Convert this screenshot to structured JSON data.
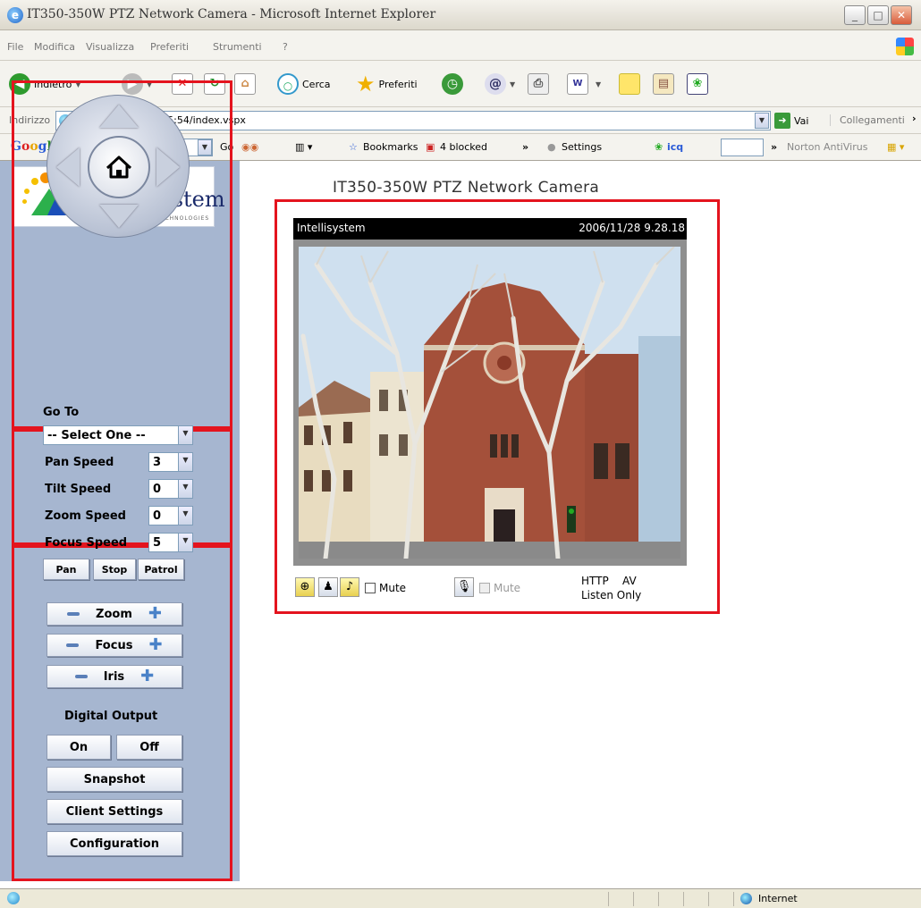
{
  "window": {
    "title": "IT350-350W PTZ Network Camera - Microsoft Internet Explorer"
  },
  "menu": [
    "File",
    "Modifica",
    "Visualizza",
    "Preferiti",
    "Strumenti",
    "?"
  ],
  "toolbar": {
    "back": "Indietro",
    "search": "Cerca",
    "favorites": "Preferiti"
  },
  "address": {
    "label": "Indirizzo",
    "url": "http://172.16.10.75:54/index.vspx",
    "go": "Vai",
    "links": "Collegamenti"
  },
  "google_bar": {
    "logo": "Google",
    "go": "Go",
    "bookmarks": "Bookmarks",
    "blocked": "4 blocked",
    "settings": "Settings",
    "icq": "icq",
    "norton": "Norton AntiVirus"
  },
  "logo": {
    "text": "Intellisystem",
    "tagline": "TECHNOLOGIES"
  },
  "ptz": {
    "goto_label": "Go To",
    "goto_value": "-- Select One --",
    "pan_speed_label": "Pan Speed",
    "pan_speed": "3",
    "tilt_speed_label": "Tilt Speed",
    "tilt_speed": "0",
    "zoom_speed_label": "Zoom Speed",
    "zoom_speed": "0",
    "focus_speed_label": "Focus Speed",
    "focus_speed": "5",
    "pan_btn": "Pan",
    "stop_btn": "Stop",
    "patrol_btn": "Patrol"
  },
  "lens": {
    "zoom": "Zoom",
    "focus": "Focus",
    "iris": "Iris"
  },
  "output": {
    "title": "Digital Output",
    "on": "On",
    "off": "Off",
    "snapshot": "Snapshot",
    "client_settings": "Client Settings",
    "configuration": "Configuration"
  },
  "main": {
    "title": "IT350-350W PTZ Network Camera"
  },
  "camera": {
    "name": "Intellisystem",
    "timestamp": "2006/11/28 9.28.18"
  },
  "controls": {
    "mute1": "Mute",
    "mute2": "Mute",
    "protocol": "HTTP",
    "mode": "AV",
    "listen": "Listen Only"
  },
  "status": {
    "zone": "Internet"
  },
  "colors": {
    "sidebar": "#a6b6d0",
    "highlight_border": "#e4141e"
  }
}
